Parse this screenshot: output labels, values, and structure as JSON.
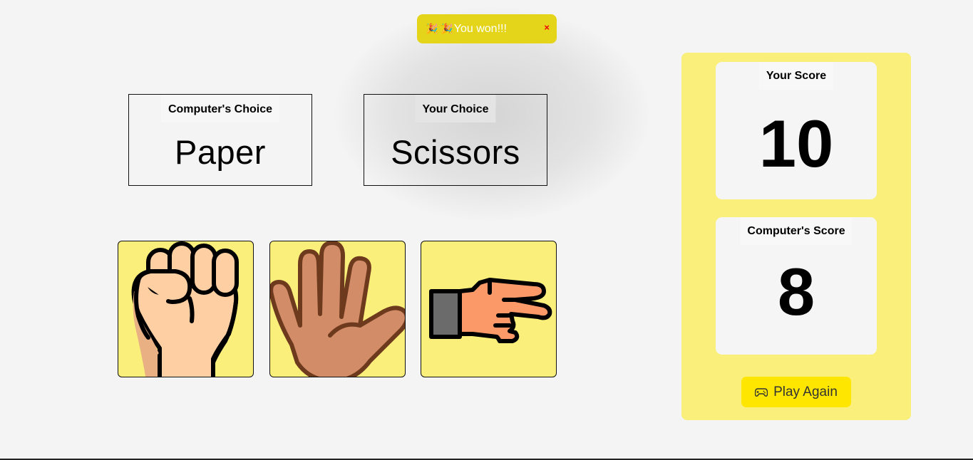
{
  "toast": {
    "icons": "🎉 🎉",
    "message": "You won!!!",
    "close_label": "×"
  },
  "computer_choice": {
    "label": "Computer's Choice",
    "value": "Paper"
  },
  "your_choice": {
    "label": "Your Choice",
    "value": "Scissors"
  },
  "moves": [
    {
      "name": "Rock",
      "icon": "fist-icon"
    },
    {
      "name": "Paper",
      "icon": "open-hand-icon"
    },
    {
      "name": "Scissors",
      "icon": "scissors-hand-icon"
    }
  ],
  "scores": {
    "you": {
      "label": "Your Score",
      "value": "10"
    },
    "computer": {
      "label": "Computer's Score",
      "value": "8"
    }
  },
  "play_again": {
    "label": "Play Again",
    "icon": "gamepad-icon"
  },
  "colors": {
    "background": "#f4f4f4",
    "toast": "#e5d51a",
    "panel": "#f9ef7a",
    "button": "#ffe600"
  }
}
